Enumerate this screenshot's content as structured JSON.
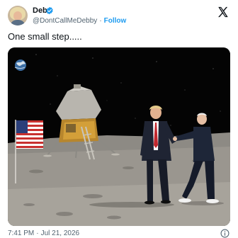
{
  "author": {
    "display_name": "Deb",
    "handle": "@DontCallMeDebby",
    "separator": "·",
    "follow_label": "Follow",
    "verified_icon": "verified-badge-icon",
    "verified_color": "#1d9bf0"
  },
  "tweet": {
    "text": "One small step....."
  },
  "meta": {
    "time": "7:41 PM",
    "separator": "·",
    "date": "Jul 21, 2026"
  },
  "icons": {
    "close": "x-logo-icon",
    "info": "info-icon"
  },
  "colors": {
    "accent": "#1d9bf0",
    "text_primary": "#0f1419",
    "text_secondary": "#536471"
  }
}
